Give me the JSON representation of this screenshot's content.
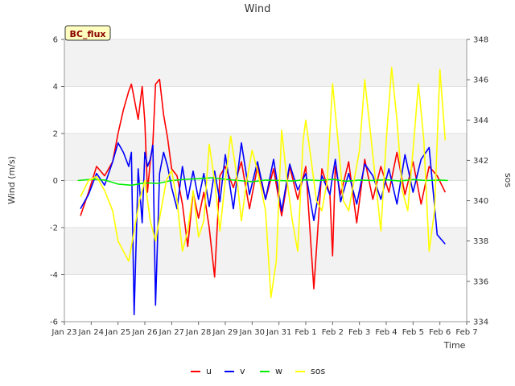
{
  "chart_data": {
    "type": "line",
    "title": "Wind",
    "badge": "BC_flux",
    "xlabel": "Time",
    "ylabel": "Wind (m/s)",
    "y2label": "sos",
    "x_ticks": [
      "Jan 23",
      "Jan 24",
      "Jan 25",
      "Jan 26",
      "Jan 27",
      "Jan 28",
      "Jan 29",
      "Jan 30",
      "Jan 31",
      "Feb 1",
      "Feb 2",
      "Feb 3",
      "Feb 4",
      "Feb 5",
      "Feb 6",
      "Feb 7"
    ],
    "y_ticks": [
      "-6",
      "-4",
      "-2",
      "0",
      "2",
      "4",
      "6"
    ],
    "y2_ticks": [
      "334",
      "336",
      "338",
      "340",
      "342",
      "344",
      "346",
      "348"
    ],
    "xlim_days": [
      0,
      15
    ],
    "ylim": [
      -6,
      6
    ],
    "y2lim": [
      334,
      348
    ],
    "grid": true,
    "legend_position": "bottom-center",
    "series": [
      {
        "name": "u",
        "color": "#ff0000",
        "axis": "left",
        "x": [
          0.6,
          0.9,
          1.2,
          1.5,
          1.8,
          2.0,
          2.2,
          2.4,
          2.5,
          2.6,
          2.75,
          2.9,
          3.0,
          3.1,
          3.2,
          3.3,
          3.4,
          3.55,
          3.7,
          3.85,
          4.0,
          4.2,
          4.4,
          4.6,
          4.8,
          5.0,
          5.2,
          5.4,
          5.6,
          5.8,
          6.0,
          6.3,
          6.6,
          6.9,
          7.2,
          7.5,
          7.8,
          8.1,
          8.4,
          8.7,
          9.0,
          9.3,
          9.6,
          9.9,
          10.0,
          10.1,
          10.3,
          10.6,
          10.9,
          11.2,
          11.5,
          11.8,
          12.1,
          12.4,
          12.7,
          13.0,
          13.3,
          13.6,
          13.9,
          14.2
        ],
        "y": [
          -1.5,
          -0.5,
          0.6,
          0.2,
          0.8,
          2.0,
          3.0,
          3.8,
          4.1,
          3.5,
          2.6,
          4.0,
          2.5,
          -0.5,
          0.8,
          1.6,
          4.1,
          4.3,
          2.8,
          1.8,
          0.5,
          0.2,
          -1.0,
          -2.8,
          -0.5,
          -1.6,
          -0.5,
          -2.0,
          -4.1,
          0.2,
          0.6,
          -0.3,
          0.8,
          -1.2,
          0.6,
          -0.8,
          0.5,
          -1.5,
          0.6,
          -0.8,
          0.6,
          -4.6,
          0.5,
          -0.6,
          -3.2,
          0.6,
          -0.6,
          0.8,
          -1.8,
          0.9,
          -0.8,
          0.6,
          -0.5,
          1.2,
          -0.6,
          0.8,
          -1.0,
          0.6,
          0.2,
          -0.5
        ]
      },
      {
        "name": "v",
        "color": "#0000ff",
        "axis": "left",
        "x": [
          0.6,
          0.9,
          1.2,
          1.5,
          1.8,
          2.0,
          2.2,
          2.4,
          2.5,
          2.6,
          2.75,
          2.9,
          3.0,
          3.1,
          3.2,
          3.3,
          3.4,
          3.55,
          3.7,
          3.85,
          4.0,
          4.2,
          4.4,
          4.6,
          4.8,
          5.0,
          5.2,
          5.4,
          5.6,
          5.8,
          6.0,
          6.3,
          6.6,
          6.9,
          7.2,
          7.5,
          7.8,
          8.1,
          8.4,
          8.7,
          9.0,
          9.3,
          9.6,
          9.9,
          10.0,
          10.1,
          10.3,
          10.6,
          10.9,
          11.2,
          11.5,
          11.8,
          12.1,
          12.4,
          12.7,
          13.0,
          13.3,
          13.6,
          13.9,
          14.2
        ],
        "y": [
          -1.2,
          -0.6,
          0.3,
          -0.2,
          0.8,
          1.6,
          1.2,
          0.6,
          1.2,
          -5.7,
          0.5,
          -1.8,
          1.2,
          0.6,
          0.9,
          1.5,
          -5.3,
          0.3,
          1.2,
          0.6,
          -0.3,
          -1.2,
          0.6,
          -0.8,
          0.4,
          -0.8,
          0.3,
          -1.1,
          0.4,
          -0.9,
          1.1,
          -1.2,
          1.6,
          -0.6,
          0.8,
          -0.8,
          0.9,
          -1.3,
          0.7,
          -0.4,
          0.3,
          -1.7,
          0.2,
          -0.6,
          0.2,
          0.9,
          -0.9,
          0.3,
          -1.0,
          0.7,
          0.2,
          -0.8,
          0.5,
          -1.0,
          1.1,
          -0.5,
          0.9,
          1.4,
          -2.3,
          -2.7
        ]
      },
      {
        "name": "w",
        "color": "#00ee00",
        "axis": "left",
        "x": [
          0.5,
          1.0,
          1.5,
          2.0,
          2.5,
          3.0,
          3.5,
          4.0,
          4.5,
          5.0,
          5.5,
          6.0,
          6.5,
          7.0,
          7.5,
          8.0,
          8.5,
          9.0,
          9.5,
          10.0,
          10.5,
          11.0,
          11.5,
          12.0,
          12.5,
          13.0,
          13.5,
          14.0,
          14.3
        ],
        "y": [
          0.0,
          0.05,
          0.02,
          -0.15,
          -0.2,
          -0.1,
          -0.12,
          0.0,
          0.05,
          0.08,
          0.12,
          0.05,
          0.0,
          -0.05,
          0.02,
          0.0,
          -0.02,
          0.03,
          0.0,
          0.05,
          -0.03,
          0.02,
          0.0,
          0.03,
          -0.02,
          0.04,
          0.0,
          0.02,
          0.0
        ]
      },
      {
        "name": "sos",
        "color": "#ffff00",
        "axis": "right",
        "x": [
          0.6,
          0.9,
          1.2,
          1.5,
          1.8,
          2.0,
          2.2,
          2.4,
          2.6,
          2.8,
          3.0,
          3.2,
          3.4,
          3.6,
          3.8,
          4.0,
          4.2,
          4.4,
          4.6,
          4.8,
          5.0,
          5.2,
          5.4,
          5.6,
          5.8,
          6.0,
          6.2,
          6.4,
          6.6,
          6.8,
          7.0,
          7.2,
          7.5,
          7.7,
          7.9,
          8.1,
          8.3,
          8.5,
          8.7,
          8.9,
          9.0,
          9.2,
          9.4,
          9.6,
          9.8,
          10.0,
          10.2,
          10.4,
          10.6,
          10.8,
          11.0,
          11.2,
          11.4,
          11.6,
          11.8,
          12.0,
          12.2,
          12.4,
          12.6,
          12.8,
          13.0,
          13.2,
          13.4,
          13.6,
          13.8,
          14.0,
          14.2
        ],
        "y": [
          340.2,
          341.0,
          341.2,
          340.5,
          339.5,
          338.0,
          337.5,
          337.0,
          338.5,
          340.0,
          341.0,
          339.0,
          338.0,
          339.5,
          341.0,
          341.5,
          340.0,
          337.5,
          338.5,
          340.5,
          338.2,
          339.0,
          342.8,
          341.0,
          338.5,
          341.0,
          343.2,
          341.5,
          339.0,
          341.0,
          342.5,
          341.5,
          339.5,
          335.2,
          337.0,
          343.5,
          341.0,
          339.0,
          337.5,
          343.0,
          344.0,
          342.0,
          340.0,
          339.5,
          341.0,
          345.8,
          343.0,
          340.0,
          339.5,
          341.0,
          342.5,
          346.0,
          343.5,
          341.0,
          338.5,
          343.0,
          346.6,
          344.0,
          340.5,
          339.5,
          342.5,
          345.8,
          343.0,
          337.5,
          339.5,
          346.5,
          343.0
        ]
      }
    ]
  }
}
